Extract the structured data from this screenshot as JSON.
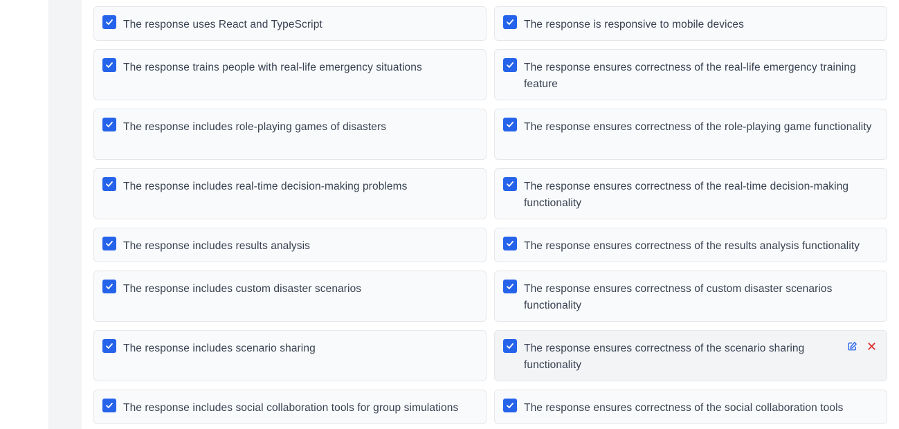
{
  "criteria": [
    {
      "label": "The response uses React and TypeScript",
      "checked": true
    },
    {
      "label": "The response is responsive to mobile devices",
      "checked": true
    },
    {
      "label": "The response trains people with real-life emergency situations",
      "checked": true
    },
    {
      "label": "The response ensures correctness of the real-life emergency training feature",
      "checked": true
    },
    {
      "label": "The response includes role-playing games of disasters",
      "checked": true
    },
    {
      "label": "The response ensures correctness of the role-playing game functionality",
      "checked": true
    },
    {
      "label": "The response includes real-time decision-making problems",
      "checked": true
    },
    {
      "label": "The response ensures correctness of the real-time decision-making functionality",
      "checked": true
    },
    {
      "label": "The response includes results analysis",
      "checked": true
    },
    {
      "label": "The response ensures correctness of the results analysis functionality",
      "checked": true
    },
    {
      "label": "The response includes custom disaster scenarios",
      "checked": true
    },
    {
      "label": "The response ensures correctness of custom disaster scenarios functionality",
      "checked": true
    },
    {
      "label": "The response includes scenario sharing",
      "checked": true
    },
    {
      "label": "The response ensures correctness of the scenario sharing functionality",
      "checked": true
    },
    {
      "label": "The response includes social collaboration tools for group simulations",
      "checked": true
    },
    {
      "label": "The response ensures correctness of the social collaboration tools",
      "checked": true
    }
  ],
  "icons": {
    "checkbox": "check-icon",
    "edit": "edit-icon",
    "delete": "close-icon"
  },
  "colors": {
    "checkbox": "#2563eb",
    "edit": "#2563eb",
    "delete": "#dc2626"
  }
}
